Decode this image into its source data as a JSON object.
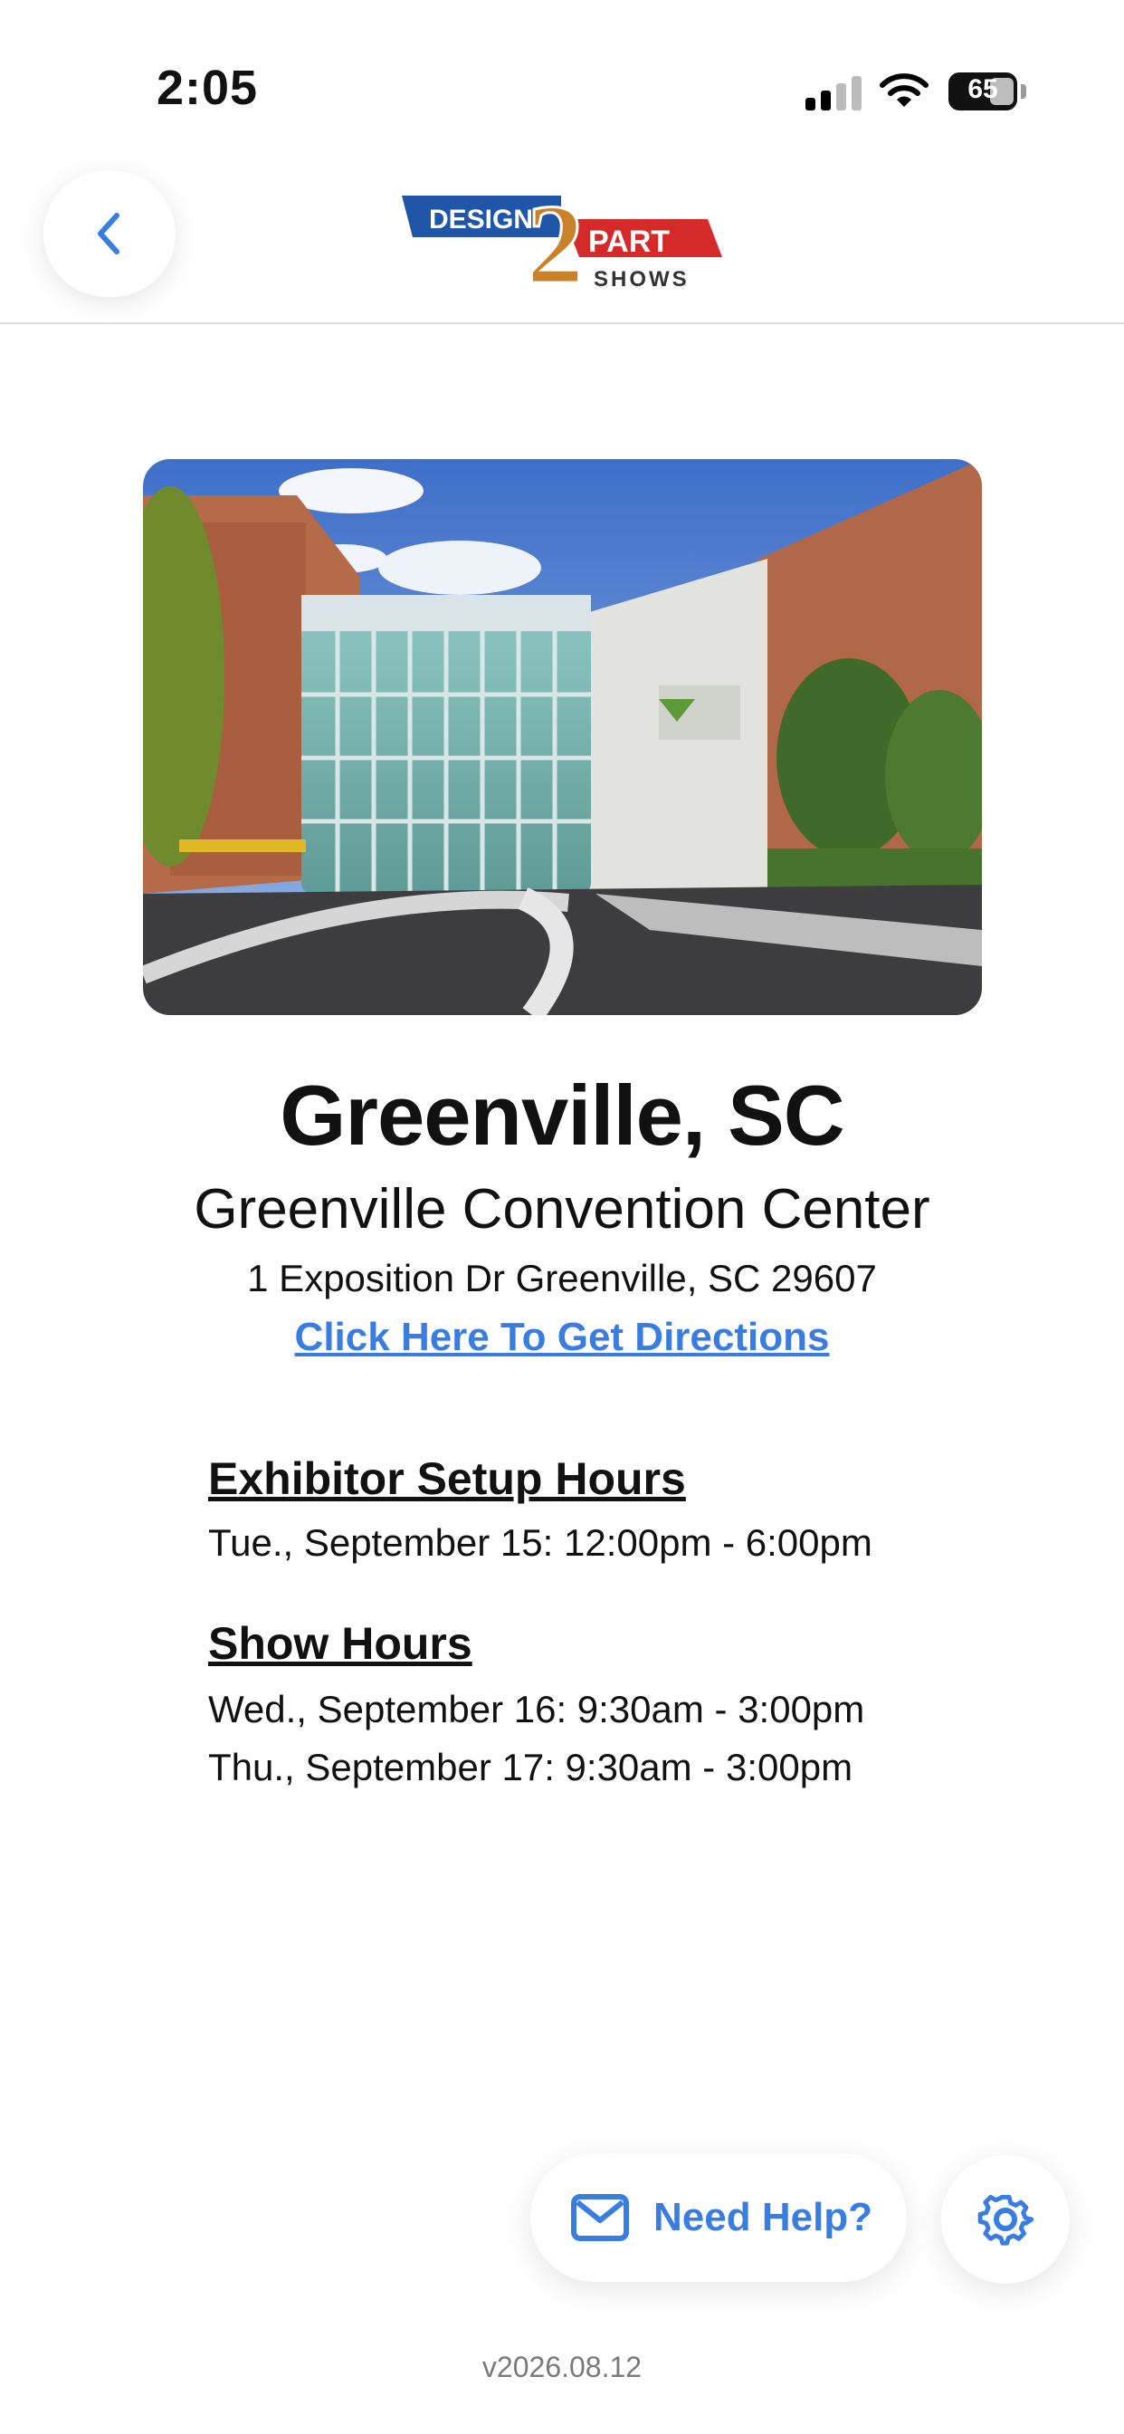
{
  "status": {
    "time": "2:05",
    "battery": "65"
  },
  "header": {
    "logo": {
      "word1": "DESIGN",
      "numeral": "2",
      "word2": "PART",
      "word3": "SHOWS"
    }
  },
  "venue": {
    "city": "Greenville, SC",
    "name": "Greenville Convention Center",
    "address": "1 Exposition Dr Greenville, SC 29607",
    "directions_link": "Click Here To Get Directions"
  },
  "setup": {
    "title": "Exhibitor Setup Hours",
    "lines": [
      "Tue., September 15: 12:00pm - 6:00pm"
    ]
  },
  "show": {
    "title": "Show Hours",
    "lines": [
      "Wed., September 16: 9:30am - 3:00pm",
      "Thu., September 17: 9:30am - 3:00pm"
    ]
  },
  "footer": {
    "help_label": "Need Help?",
    "version": "v2026.08.12"
  },
  "colors": {
    "accent": "#3a7de0",
    "logo_blue": "#1f56a8",
    "logo_red": "#d42a2a",
    "logo_gold": "#c9822a"
  },
  "icons": [
    "back-chevron-icon",
    "mail-icon",
    "gear-icon",
    "signal-icon",
    "wifi-icon",
    "battery-icon"
  ]
}
